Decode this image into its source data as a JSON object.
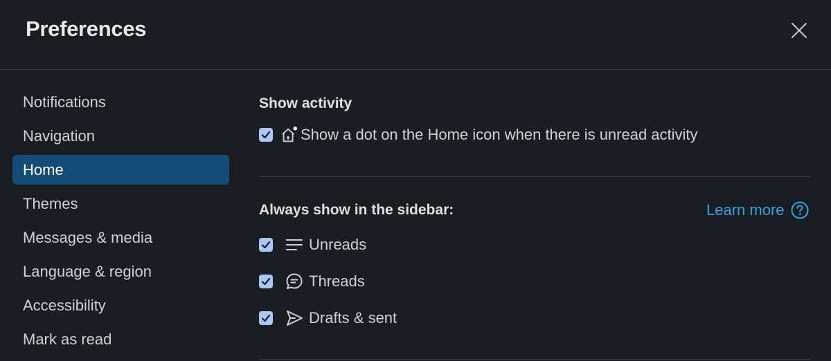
{
  "header": {
    "title": "Preferences",
    "close_icon": "close-icon"
  },
  "sidebar": {
    "items": [
      {
        "label": "Notifications",
        "active": false
      },
      {
        "label": "Navigation",
        "active": false
      },
      {
        "label": "Home",
        "active": true
      },
      {
        "label": "Themes",
        "active": false
      },
      {
        "label": "Messages & media",
        "active": false
      },
      {
        "label": "Language & region",
        "active": false
      },
      {
        "label": "Accessibility",
        "active": false
      },
      {
        "label": "Mark as read",
        "active": false
      }
    ]
  },
  "main": {
    "show_activity": {
      "title": "Show activity",
      "option": {
        "label": "Show a dot on the Home icon when there is unread activity",
        "checked": true,
        "icon": "home-dot-icon"
      }
    },
    "sidebar_section": {
      "title": "Always show in the sidebar:",
      "learn_more": "Learn more",
      "help_icon": "question-circle-icon",
      "options": [
        {
          "label": "Unreads",
          "checked": true,
          "icon": "unreads-lines-icon"
        },
        {
          "label": "Threads",
          "checked": true,
          "icon": "threads-bubble-icon"
        },
        {
          "label": "Drafts & sent",
          "checked": true,
          "icon": "send-arrow-icon"
        }
      ]
    }
  },
  "colors": {
    "background": "#1a1d21",
    "active_nav": "#124c77",
    "checkbox": "#a9c8f5",
    "link": "#36a3e0",
    "divider": "#3b3d42"
  }
}
